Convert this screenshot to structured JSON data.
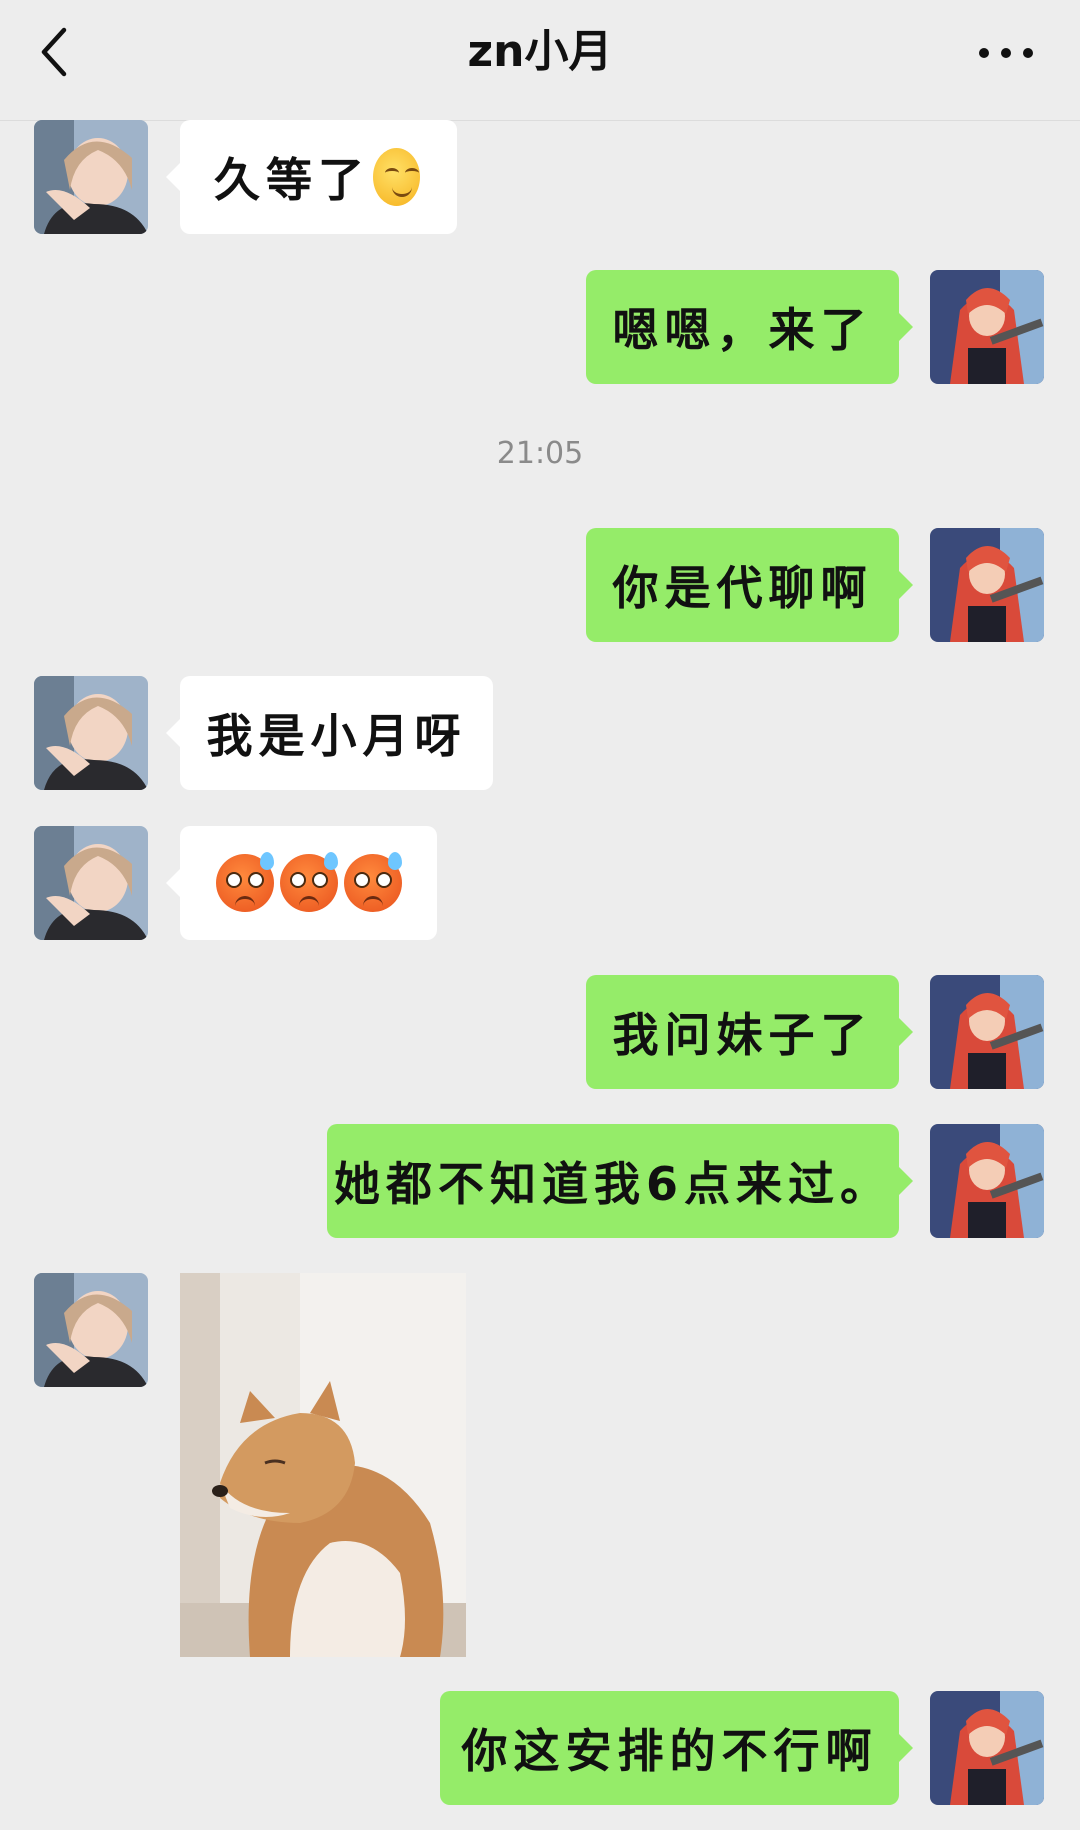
{
  "header": {
    "title": "zn小月"
  },
  "messages": [
    {
      "from": "other",
      "text": "久等了"
    },
    {
      "from": "me",
      "text": "嗯嗯，来了"
    },
    {
      "timestamp": "21:05"
    },
    {
      "from": "me",
      "text": "你是代聊啊"
    },
    {
      "from": "other",
      "text": "我是小月呀"
    },
    {
      "from": "other",
      "emoji_count": 3
    },
    {
      "from": "me",
      "text": "我问妹子了"
    },
    {
      "from": "me",
      "text": "她都不知道我6点来过。"
    },
    {
      "from": "other",
      "image": "dog-photo"
    },
    {
      "from": "me",
      "text": "你这安排的不行啊"
    }
  ],
  "icons": {
    "back": "chevron-left-icon",
    "more": "more-dots-icon",
    "smile": "blush-emoji",
    "sweat": "sweat-emoji"
  },
  "colors": {
    "background": "#ededed",
    "out_bubble": "#95ec69",
    "in_bubble": "#ffffff",
    "timestamp": "#8a8a8a"
  }
}
